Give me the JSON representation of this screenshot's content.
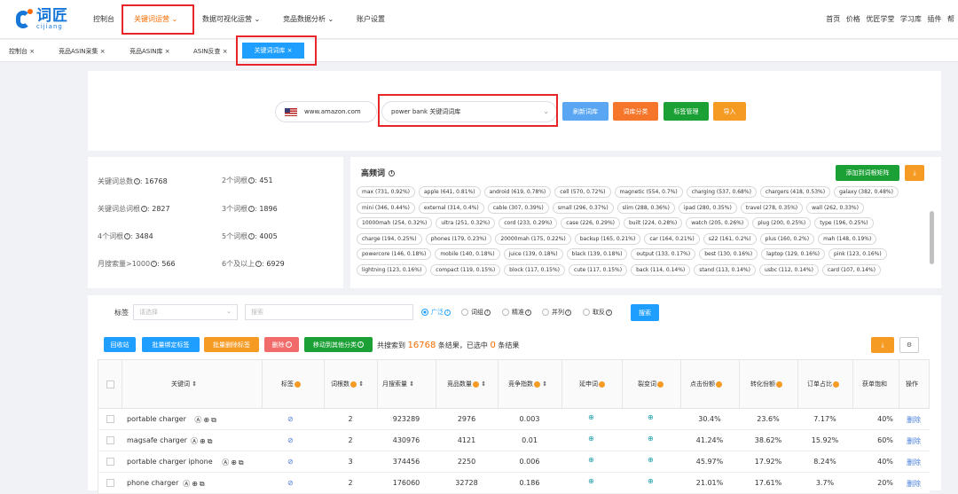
{
  "logo": {
    "cn": "词匠",
    "en": "cijiang"
  },
  "nav": {
    "items": [
      "控制台",
      "关键词运营",
      "数据可视化运营",
      "竞品数据分析",
      "账户设置"
    ],
    "right": [
      "首页",
      "价格",
      "优匠学堂",
      "学习库",
      "插件",
      "帮"
    ]
  },
  "tabs": {
    "items": [
      "控制台 ×",
      "竞品ASIN采集 ×",
      "竞品ASIN库 ×",
      "ASIN反查 ×"
    ],
    "active": "关键词词库 ×"
  },
  "search": {
    "site": "www.amazon.com",
    "library": "power bank 关键词词库",
    "buttons": [
      "刷新词库",
      "词库分类",
      "标签管理",
      "导入"
    ]
  },
  "stats": [
    {
      "label": "关键词总数",
      "value": "16768"
    },
    {
      "label": "2个词根",
      "value": "451"
    },
    {
      "label": "关键词总词根",
      "value": "2827"
    },
    {
      "label": "3个词根",
      "value": "1896"
    },
    {
      "label": "4个词根",
      "value": "3484"
    },
    {
      "label": "5个词根",
      "value": "4005"
    },
    {
      "label": "月搜索量>1000",
      "value": "566"
    },
    {
      "label": "6个及以上",
      "value": "6929"
    }
  ],
  "high_freq": {
    "title": "高频词",
    "add_button": "添加到词根矩阵",
    "export_button": "⤓",
    "chips": [
      "max (731, 0.92%)",
      "apple (641, 0.81%)",
      "android (619, 0.78%)",
      "cell (570, 0.72%)",
      "magnetic (554, 0.7%)",
      "charging (537, 0.68%)",
      "chargers (418, 0.53%)",
      "galaxy (382, 0.48%)",
      "mini (346, 0.44%)",
      "external (314, 0.4%)",
      "cable (307, 0.39%)",
      "small (296, 0.37%)",
      "slim (288, 0.36%)",
      "ipad (280, 0.35%)",
      "travel (278, 0.35%)",
      "wall (262, 0.33%)",
      "10000mah (254, 0.32%)",
      "ultra (251, 0.32%)",
      "cord (233, 0.29%)",
      "case (226, 0.29%)",
      "built (224, 0.28%)",
      "watch (205, 0.26%)",
      "plug (200, 0.25%)",
      "type (196, 0.25%)",
      "charge (194, 0.25%)",
      "phones (179, 0.23%)",
      "20000mah (175, 0.22%)",
      "backup (165, 0.21%)",
      "car (164, 0.21%)",
      "s22 (161, 0.2%)",
      "plus (160, 0.2%)",
      "mah (148, 0.19%)",
      "powercore (146, 0.18%)",
      "mobile (140, 0.18%)",
      "juice (139, 0.18%)",
      "black (139, 0.18%)",
      "output (133, 0.17%)",
      "best (130, 0.16%)",
      "laptop (129, 0.16%)",
      "pink (123, 0.16%)",
      "lightning (123, 0.16%)",
      "compact (119, 0.15%)",
      "block (117, 0.15%)",
      "cute (117, 0.15%)",
      "back (114, 0.14%)",
      "stand (113, 0.14%)",
      "usbc (112, 0.14%)",
      "card (107, 0.14%)"
    ]
  },
  "filter": {
    "tag_label": "标签",
    "tag_placeholder": "请选择",
    "search_placeholder": "搜索",
    "modes": [
      "广泛",
      "词组",
      "精准",
      "并列",
      "取反"
    ],
    "search_button": "搜索"
  },
  "actions": {
    "buttons": [
      "回收站",
      "批量绑定标签",
      "批量删除标签",
      "删除",
      "移动到其他分类"
    ],
    "result_prefix": "共搜索到",
    "result_count": "16768",
    "result_mid": "条结果，已选中",
    "selected": "0",
    "result_suffix": "条结果"
  },
  "table": {
    "headers": [
      "关键词 ⇕",
      "标签",
      "词根数",
      "月搜索量 ⇕",
      "竞品数量",
      "竞争指数",
      "延申词",
      "裂变词",
      "点击份额",
      "转化份额",
      "订单占比",
      "获单饱和",
      "操作"
    ],
    "rows": [
      {
        "kw": "portable charger",
        "roots": "2",
        "search": "923289",
        "comp": "2976",
        "idx": "0.003",
        "click": "30.4%",
        "conv": "23.6%",
        "order": "7.17%",
        "sat": "40%",
        "op": "删除"
      },
      {
        "kw": "magsafe charger",
        "roots": "2",
        "search": "430976",
        "comp": "4121",
        "idx": "0.01",
        "click": "41.24%",
        "conv": "38.62%",
        "order": "15.92%",
        "sat": "60%",
        "op": "删除"
      },
      {
        "kw": "portable charger iphone",
        "roots": "3",
        "search": "374456",
        "comp": "2250",
        "idx": "0.006",
        "click": "45.97%",
        "conv": "17.92%",
        "order": "8.24%",
        "sat": "40%",
        "op": "删除"
      },
      {
        "kw": "phone charger",
        "roots": "2",
        "search": "176060",
        "comp": "32728",
        "idx": "0.186",
        "click": "21.01%",
        "conv": "17.61%",
        "order": "3.7%",
        "sat": "20%",
        "op": "删除"
      }
    ]
  }
}
